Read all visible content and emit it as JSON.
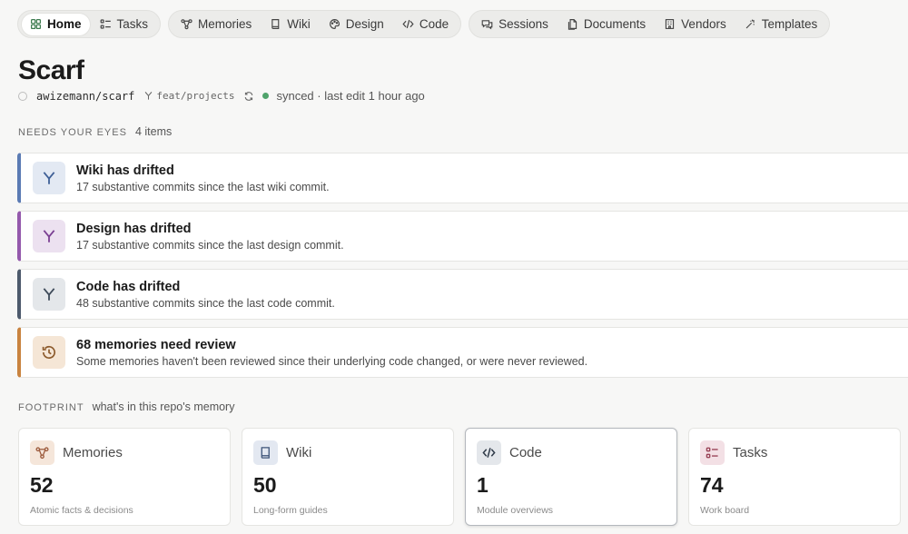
{
  "nav": {
    "groups": [
      [
        {
          "label": "Home",
          "icon": "grid-icon",
          "active": true
        },
        {
          "label": "Tasks",
          "icon": "list-icon"
        }
      ],
      [
        {
          "label": "Memories",
          "icon": "nodes-icon"
        },
        {
          "label": "Wiki",
          "icon": "book-icon"
        },
        {
          "label": "Design",
          "icon": "palette-icon"
        },
        {
          "label": "Code",
          "icon": "code-icon"
        }
      ],
      [
        {
          "label": "Sessions",
          "icon": "chat-icon"
        },
        {
          "label": "Documents",
          "icon": "documents-icon"
        },
        {
          "label": "Vendors",
          "icon": "building-icon"
        },
        {
          "label": "Templates",
          "icon": "wand-icon"
        }
      ]
    ]
  },
  "page": {
    "title": "Scarf",
    "repo": "awizemann/scarf",
    "branch": "feat/projects",
    "sync_status": "synced · last edit 1 hour ago"
  },
  "attention": {
    "label": "NEEDS YOUR EYES",
    "count": "4 items",
    "items": [
      {
        "title": "Wiki has drifted",
        "desc": "17 substantive commits since the last wiki commit.",
        "icon": "branch-icon",
        "accent": "#5b7bb4",
        "icon_bg": "#e3e9f3",
        "icon_color": "#3e5f96"
      },
      {
        "title": "Design has drifted",
        "desc": "17 substantive commits since the last design commit.",
        "icon": "branch-icon",
        "accent": "#9459ac",
        "icon_bg": "#ece1f0",
        "icon_color": "#7a3f92"
      },
      {
        "title": "Code has drifted",
        "desc": "48 substantive commits since the last code commit.",
        "icon": "branch-icon",
        "accent": "#4d5a6c",
        "icon_bg": "#e4e7ea",
        "icon_color": "#3e4a59"
      },
      {
        "title": "68 memories need review",
        "desc": "Some memories haven't been reviewed since their underlying code changed, or were never reviewed.",
        "icon": "history-icon",
        "accent": "#c9833f",
        "icon_bg": "#f5e6d6",
        "icon_color": "#8c5a2c"
      }
    ]
  },
  "footprint": {
    "label": "FOOTPRINT",
    "sub": "what's in this repo's memory",
    "cards": [
      {
        "name": "Memories",
        "value": "52",
        "desc": "Atomic facts & decisions",
        "icon": "nodes-icon",
        "icon_bg": "#f5e6da",
        "icon_color": "#9c5a3c"
      },
      {
        "name": "Wiki",
        "value": "50",
        "desc": "Long-form guides",
        "icon": "book-icon",
        "icon_bg": "#e3e8f1",
        "icon_color": "#3e5478"
      },
      {
        "name": "Code",
        "value": "1",
        "desc": "Module overviews",
        "icon": "code-icon",
        "icon_bg": "#e4e7eb",
        "icon_color": "#2f3a48",
        "selected": true
      },
      {
        "name": "Tasks",
        "value": "74",
        "desc": "Work board",
        "icon": "list-icon",
        "icon_bg": "#f3e0e5",
        "icon_color": "#9a4458"
      }
    ]
  }
}
